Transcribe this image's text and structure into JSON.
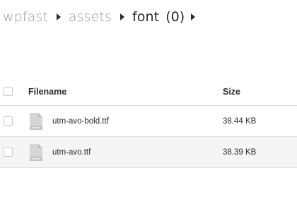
{
  "breadcrumb": {
    "items": [
      "wpfast",
      "assets",
      "font"
    ],
    "count": "(0)"
  },
  "table": {
    "columns": {
      "filename": "Filename",
      "size": "Size"
    },
    "rows": [
      {
        "name": "utm-avo-bold.ttf",
        "size": "38.44 KB",
        "icon": "document-icon"
      },
      {
        "name": "utm-avo.ttf",
        "size": "38.39 KB",
        "icon": "document-icon"
      }
    ]
  },
  "colors": {
    "breadcrumb_inactive": "#9a9a9a",
    "text": "#2b2b2b",
    "hover_row": "#f5f5f5",
    "icon_fill": "#d6d6d6"
  }
}
